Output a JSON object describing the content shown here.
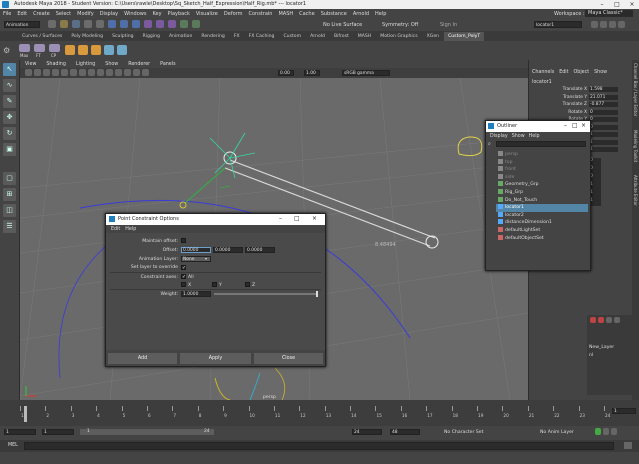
{
  "window": {
    "title": "Autodesk Maya 2018 - Student Version: C:\\Users\\rawle\\Desktop\\Sq_Sketch_Half_Expression\\Half_Rig.mb*  ---  locator1",
    "workspace_label": "Workspace :",
    "workspace_value": "Maya Classic*"
  },
  "menubar": [
    "File",
    "Edit",
    "Create",
    "Select",
    "Modify",
    "Display",
    "Windows",
    "Key",
    "Playback",
    "Visualize",
    "Deform",
    "Constrain",
    "MASH",
    "Cache",
    "Substance",
    "Arnold",
    "Help"
  ],
  "statusline": {
    "mode": "Animation",
    "live_surface": "No Live Surface",
    "symmetry": "Symmetry: Off",
    "user_label": "Sign In",
    "search_value": "locator1"
  },
  "shelf_tabs": [
    "Curves / Surfaces",
    "Poly Modeling",
    "Sculpting",
    "Rigging",
    "Animation",
    "Rendering",
    "FX",
    "FX Caching",
    "Custom",
    "Arnold",
    "Bifrost",
    "MASH",
    "Motion Graphics",
    "XGen",
    "Custom_PolyT"
  ],
  "shelf_active": "Custom_PolyT",
  "shelf_icon_labels": [
    "Max",
    "FT",
    "CP"
  ],
  "viewport": {
    "menus": [
      "View",
      "Shading",
      "Lighting",
      "Show",
      "Renderer",
      "Panels"
    ],
    "value_a": "0.00",
    "value_b": "1.00",
    "color_space": "sRGB gamma",
    "distance_label": "8.48494",
    "camera_label": "persp"
  },
  "channel_box": {
    "menus": [
      "Channels",
      "Edit",
      "Object",
      "Show"
    ],
    "object_name": "locator1",
    "channels": [
      {
        "name": "Translate X",
        "value": "1.598"
      },
      {
        "name": "Translate Y",
        "value": "21.071"
      },
      {
        "name": "Translate Z",
        "value": "-0.877"
      },
      {
        "name": "Rotate X",
        "value": "0"
      },
      {
        "name": "Rotate Y",
        "value": "0"
      },
      {
        "name": "Rotate Z",
        "value": "0"
      },
      {
        "name": "Scale X",
        "value": "1"
      },
      {
        "name": "Scale Y",
        "value": "1"
      },
      {
        "name": "Scale Z",
        "value": "1"
      }
    ],
    "shape_values": [
      "0",
      "0",
      "0",
      "1",
      "1",
      "1"
    ],
    "layer_label": "New_Layer",
    "layer_label_short": "nl"
  },
  "side_tabs": [
    "Channel Box / Layer Editor",
    "Modeling Toolkit",
    "Attribute Editor"
  ],
  "dialog": {
    "title": "Point Constraint Options",
    "menus": [
      "Edit",
      "Help"
    ],
    "maintain_offset_label": "Maintain offset:",
    "offset_label": "Offset:",
    "offset_values": [
      "0.0000",
      "0.0000",
      "0.0000"
    ],
    "anim_layer_label": "Animation Layer:",
    "anim_layer_value": "None",
    "set_layer_label": "Set layer to override",
    "constraint_axes_label": "Constraint axes:",
    "axis_all_label": "All",
    "axes": [
      "X",
      "Y",
      "Z"
    ],
    "weight_label": "Weight:",
    "weight_value": "1.0000",
    "weight_fraction": 1.0,
    "buttons": {
      "add": "Add",
      "apply": "Apply",
      "close": "Close"
    }
  },
  "outliner": {
    "title": "Outliner",
    "menus": [
      "Display",
      "Show",
      "Help"
    ],
    "items": [
      {
        "label": "persp",
        "dim": true,
        "selected": false
      },
      {
        "label": "top",
        "dim": true,
        "selected": false
      },
      {
        "label": "front",
        "dim": true,
        "selected": false
      },
      {
        "label": "side",
        "dim": true,
        "selected": false
      },
      {
        "label": "Geometry_Grp",
        "dim": false,
        "selected": false
      },
      {
        "label": "Rig_Grp",
        "dim": false,
        "selected": false
      },
      {
        "label": "Do_Not_Touch",
        "dim": false,
        "selected": false
      },
      {
        "label": "locator1",
        "dim": false,
        "selected": true
      },
      {
        "label": "locator2",
        "dim": false,
        "selected": false
      },
      {
        "label": "distanceDimension1",
        "dim": false,
        "selected": false
      },
      {
        "label": "defaultLightSet",
        "dim": false,
        "selected": false
      },
      {
        "label": "defaultObjectSet",
        "dim": false,
        "selected": false
      }
    ]
  },
  "timeslider": {
    "ticks": [
      "1",
      "2",
      "3",
      "4",
      "5",
      "6",
      "7",
      "8",
      "9",
      "10",
      "11",
      "12",
      "13",
      "14",
      "15",
      "16",
      "17",
      "18",
      "19",
      "20",
      "21",
      "22",
      "23",
      "24"
    ],
    "current_frame": "1"
  },
  "range": {
    "start": "1",
    "inner_start": "1",
    "inner_end": "24",
    "end_a": "24",
    "end_b": "48",
    "char_set": "No Character Set",
    "anim_layer": "No Anim Layer"
  },
  "cmdline": {
    "mode": "MEL"
  },
  "colors": {
    "accent": "#5285a6",
    "viewport": "#6a6a6a",
    "panel": "#444444"
  }
}
